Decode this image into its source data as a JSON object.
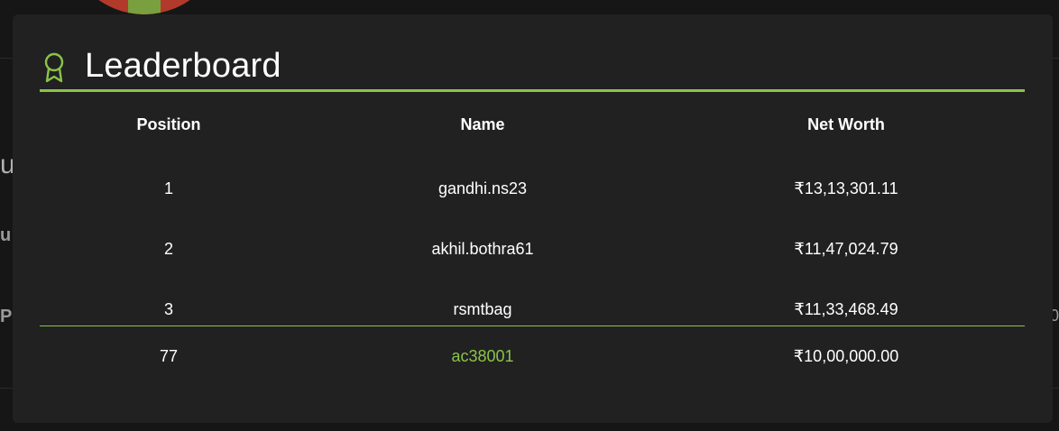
{
  "background": {
    "peek_u": "u",
    "peek_ul": "u",
    "peek_p": "P",
    "peek_zero": "0"
  },
  "leaderboard": {
    "title": "Leaderboard",
    "icon": "award-icon",
    "accent_color": "#8bc34a",
    "columns": [
      "Position",
      "Name",
      "Net Worth"
    ],
    "rows": [
      {
        "position": "1",
        "name": "gandhi.ns23",
        "net_worth": "₹13,13,301.11"
      },
      {
        "position": "2",
        "name": "akhil.bothra61",
        "net_worth": "₹11,47,024.79"
      },
      {
        "position": "3",
        "name": "rsmtbag",
        "net_worth": "₹11,33,468.49"
      }
    ],
    "current_user": {
      "position": "77",
      "name": "ac38001",
      "net_worth": "₹10,00,000.00"
    }
  }
}
